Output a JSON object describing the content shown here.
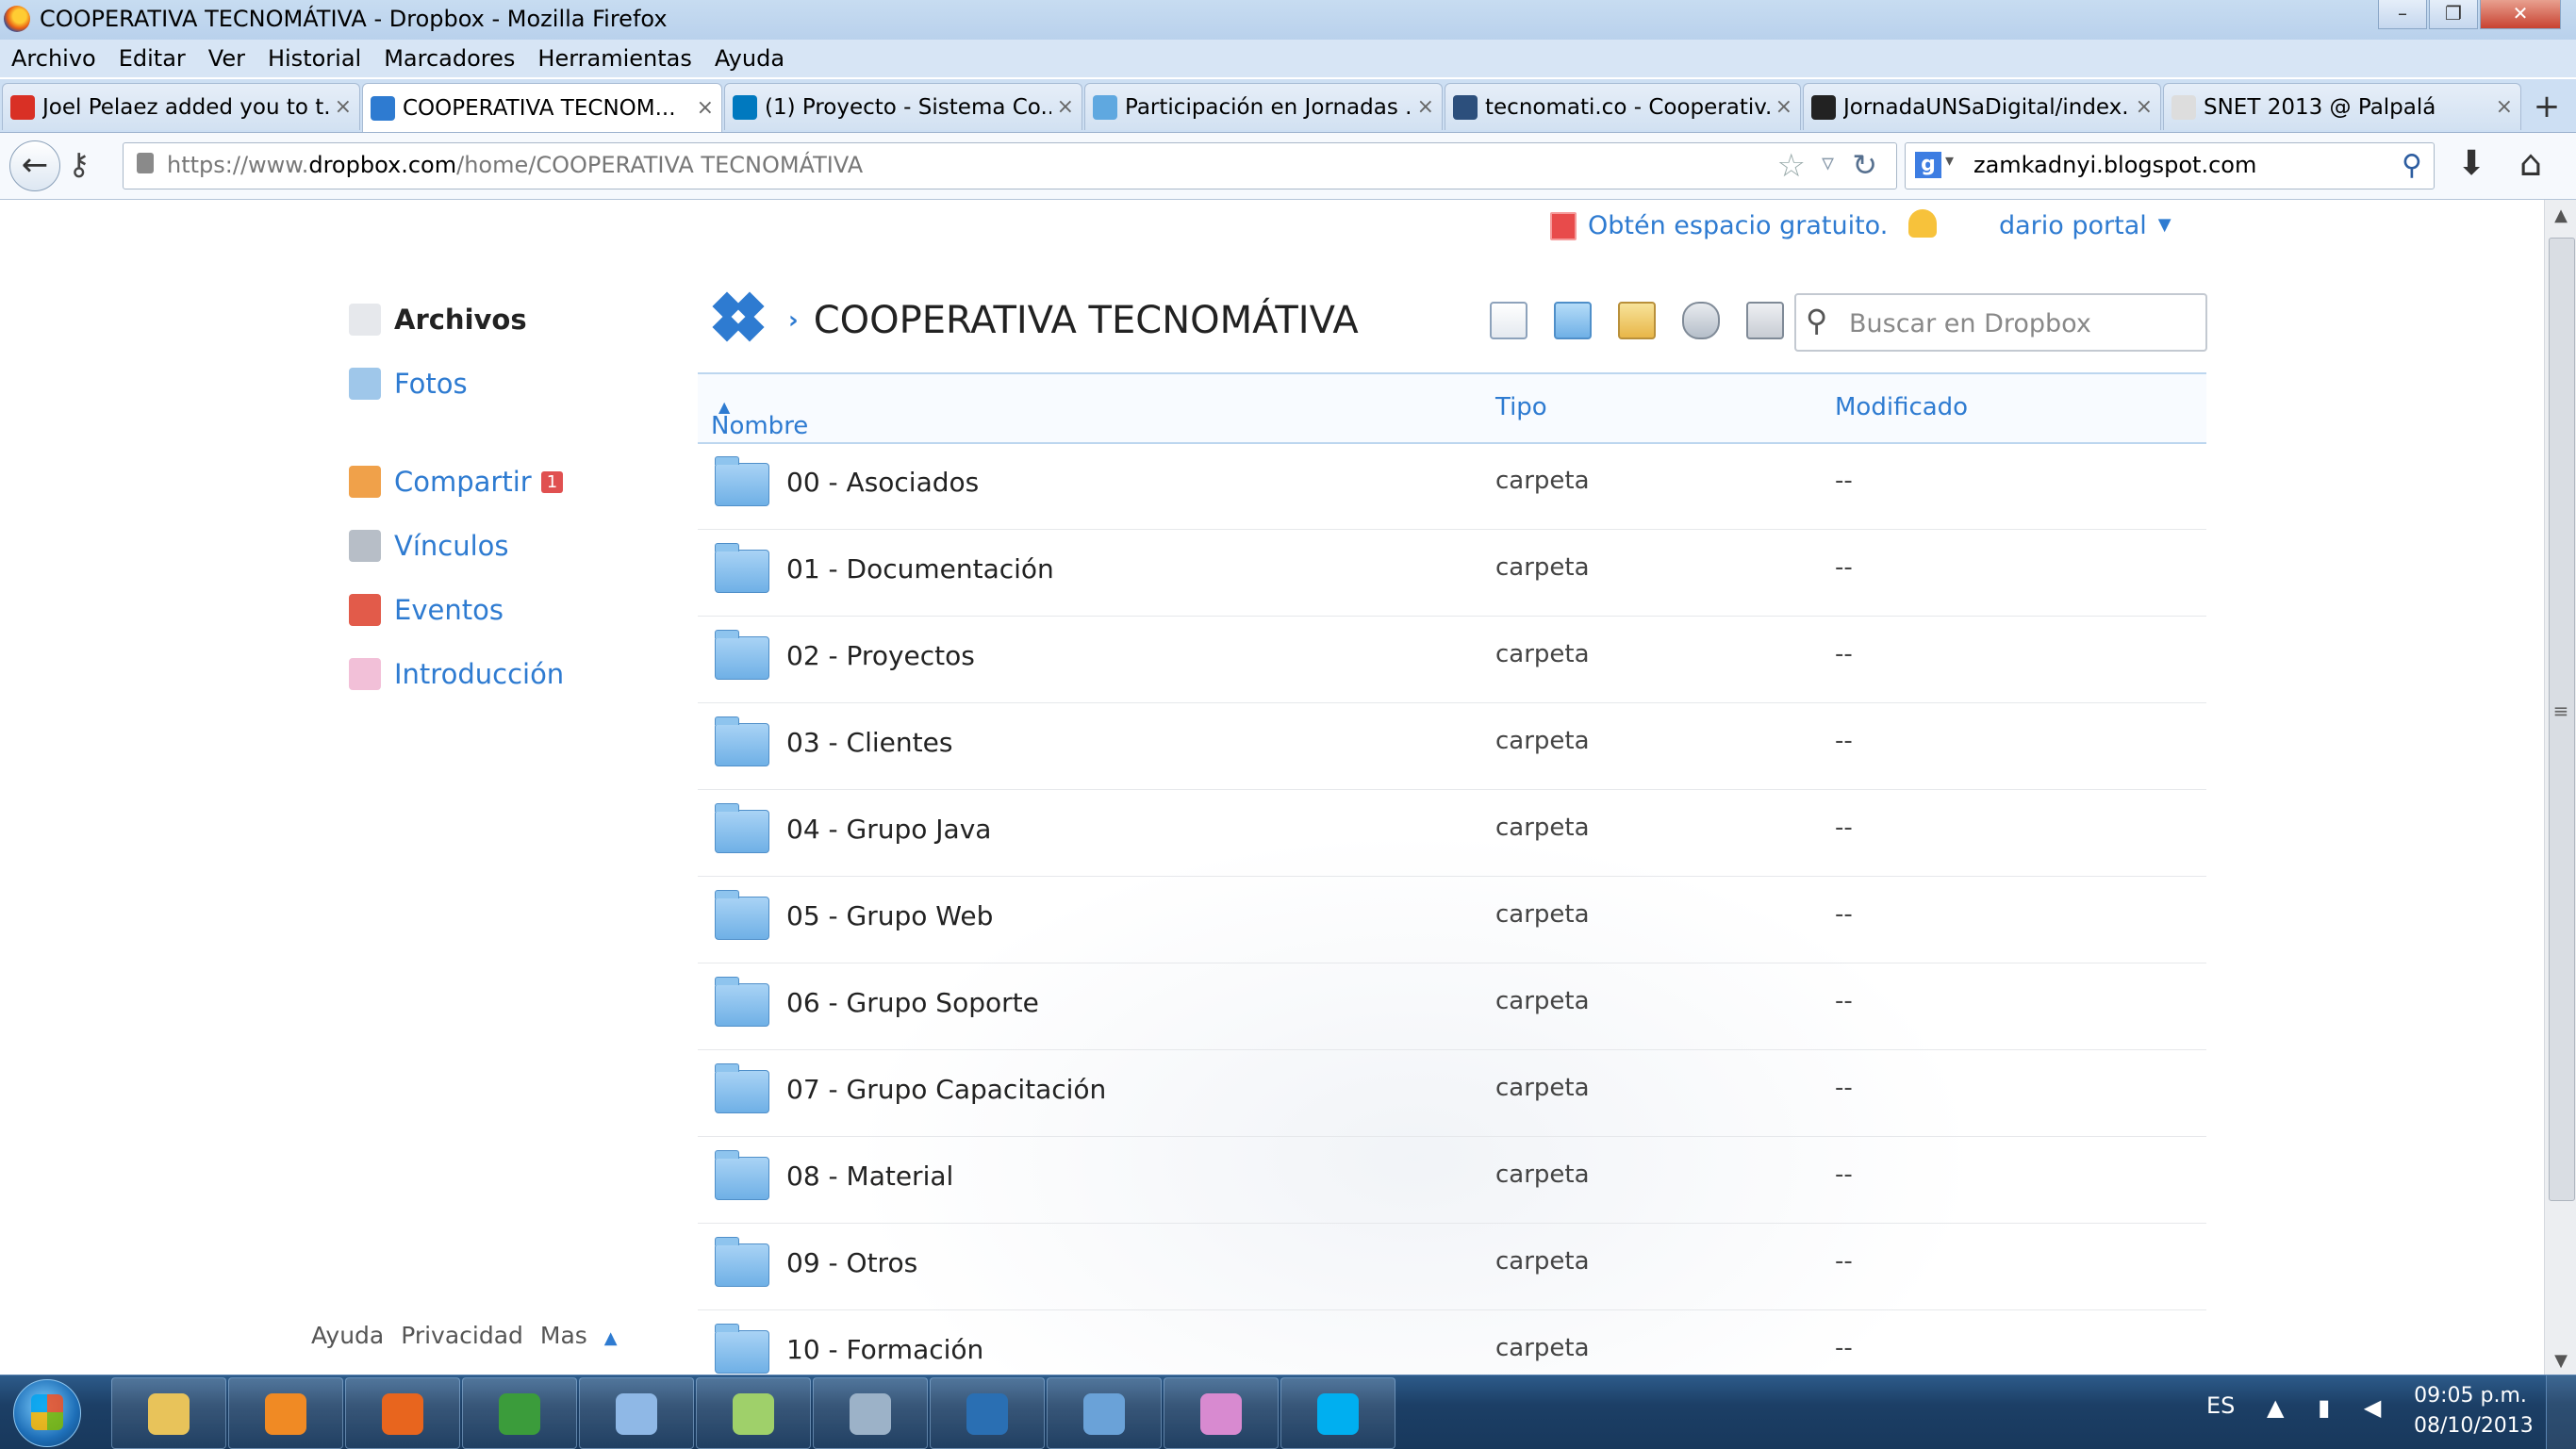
{
  "window": {
    "title": "COOPERATIVA TECNOMÁTIVA - Dropbox - Mozilla Firefox",
    "controls": [
      "–",
      "❐",
      "✕"
    ]
  },
  "menu": [
    "Archivo",
    "Editar",
    "Ver",
    "Historial",
    "Marcadores",
    "Herramientas",
    "Ayuda"
  ],
  "tabs": [
    {
      "label": "Joel Pelaez added you to t...",
      "icon": "gmail-icon",
      "color": "#d93025"
    },
    {
      "label": "COOPERATIVA TECNOM...",
      "icon": "dropbox-icon",
      "color": "#2e7bd1",
      "active": true
    },
    {
      "label": "(1) Proyecto - Sistema Co...",
      "icon": "trello-icon",
      "color": "#0079bf"
    },
    {
      "label": "Participación en Jornadas ...",
      "icon": "site-icon",
      "color": "#5fa8e0"
    },
    {
      "label": "tecnomati.co - Cooperativ...",
      "icon": "site-icon",
      "color": "#2c4f7c"
    },
    {
      "label": "JornadaUNSaDigital/index...",
      "icon": "github-icon",
      "color": "#222222"
    },
    {
      "label": "SNET 2013 @ Palpalá",
      "icon": "blank-page-icon",
      "color": "#dddddd"
    }
  ],
  "newtab": "+",
  "nav": {
    "url_prefix": "https://www.",
    "url_domain": "dropbox.com",
    "url_path": "/home/COOPERATIVA TECNOMÁTIVA",
    "search_engine": "g",
    "search_text": "zamkadnyi.blogspot.com"
  },
  "header": {
    "promo": "Obtén espacio gratuito.",
    "user": "dario portal",
    "user_caret": "▼"
  },
  "sidebar": [
    {
      "label": "Archivos",
      "icon": "files-icon",
      "current": true
    },
    {
      "label": "Fotos",
      "icon": "photos-icon"
    },
    {
      "label": "Compartir",
      "icon": "share-icon",
      "badge": "1"
    },
    {
      "label": "Vínculos",
      "icon": "links-icon"
    },
    {
      "label": "Eventos",
      "icon": "events-icon"
    },
    {
      "label": "Introducción",
      "icon": "intro-icon"
    }
  ],
  "footer": {
    "help": "Ayuda",
    "privacy": "Privacidad",
    "more": "Mas",
    "arrow": "▲"
  },
  "breadcrumb": {
    "separator": "›",
    "folder": "COOPERATIVA TECNOMÁTIVA"
  },
  "search": {
    "placeholder": "Buscar en Dropbox"
  },
  "table": {
    "columns": {
      "name": "Nombre",
      "sort_arrow": "▲",
      "type": "Tipo",
      "modified": "Modificado"
    },
    "rows": [
      {
        "name": "00 - Asociados",
        "type": "carpeta",
        "modified": "--"
      },
      {
        "name": "01 - Documentación",
        "type": "carpeta",
        "modified": "--"
      },
      {
        "name": "02 - Proyectos",
        "type": "carpeta",
        "modified": "--"
      },
      {
        "name": "03 - Clientes",
        "type": "carpeta",
        "modified": "--"
      },
      {
        "name": "04 - Grupo Java",
        "type": "carpeta",
        "modified": "--"
      },
      {
        "name": "05 - Grupo Web",
        "type": "carpeta",
        "modified": "--"
      },
      {
        "name": "06 - Grupo Soporte",
        "type": "carpeta",
        "modified": "--"
      },
      {
        "name": "07 - Grupo Capacitación",
        "type": "carpeta",
        "modified": "--"
      },
      {
        "name": "08 - Material",
        "type": "carpeta",
        "modified": "--"
      },
      {
        "name": "09 - Otros",
        "type": "carpeta",
        "modified": "--"
      },
      {
        "name": "10 - Formación",
        "type": "carpeta",
        "modified": "--"
      }
    ]
  },
  "taskbar": {
    "apps": [
      {
        "name": "explorer-icon",
        "color": "#e8c35a"
      },
      {
        "name": "media-player-icon",
        "color": "#f08a24"
      },
      {
        "name": "firefox-icon",
        "color": "#e8651e"
      },
      {
        "name": "chrome-icon",
        "color": "#3b9c3b"
      },
      {
        "name": "virtualbox-icon",
        "color": "#8fb8e6"
      },
      {
        "name": "notepad-chart-icon",
        "color": "#9fd06a"
      },
      {
        "name": "cat-app-icon",
        "color": "#9cb2c8"
      },
      {
        "name": "powershell-icon",
        "color": "#2a6fb3"
      },
      {
        "name": "picture-viewer-icon",
        "color": "#6aa2d8"
      },
      {
        "name": "paint-icon",
        "color": "#d88ad0"
      },
      {
        "name": "skype-icon",
        "color": "#00aff0"
      }
    ],
    "lang": "ES",
    "tray": "▲ ▮ ◀",
    "time": "09:05 p.m.",
    "date": "08/10/2013"
  }
}
